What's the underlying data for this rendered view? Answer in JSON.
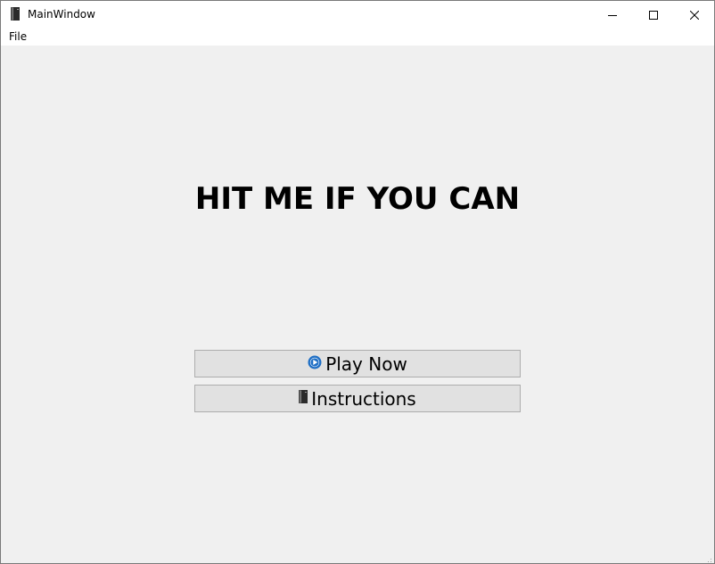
{
  "window": {
    "title": "MainWindow",
    "icon": "book-icon",
    "controls": [
      "minimize-icon",
      "maximize-icon",
      "close-icon"
    ]
  },
  "menubar": {
    "items": [
      {
        "label": "File"
      }
    ]
  },
  "main": {
    "heading": "HIT ME IF YOU CAN",
    "buttons": [
      {
        "label": "Play Now",
        "icon": "play-circle-icon",
        "icon_color": "#1f6fc5"
      },
      {
        "label": "Instructions",
        "icon": "book-icon"
      }
    ]
  },
  "colors": {
    "client_background": "#f0f0f0",
    "button_background": "#e1e1e1",
    "button_border": "#adadad"
  }
}
